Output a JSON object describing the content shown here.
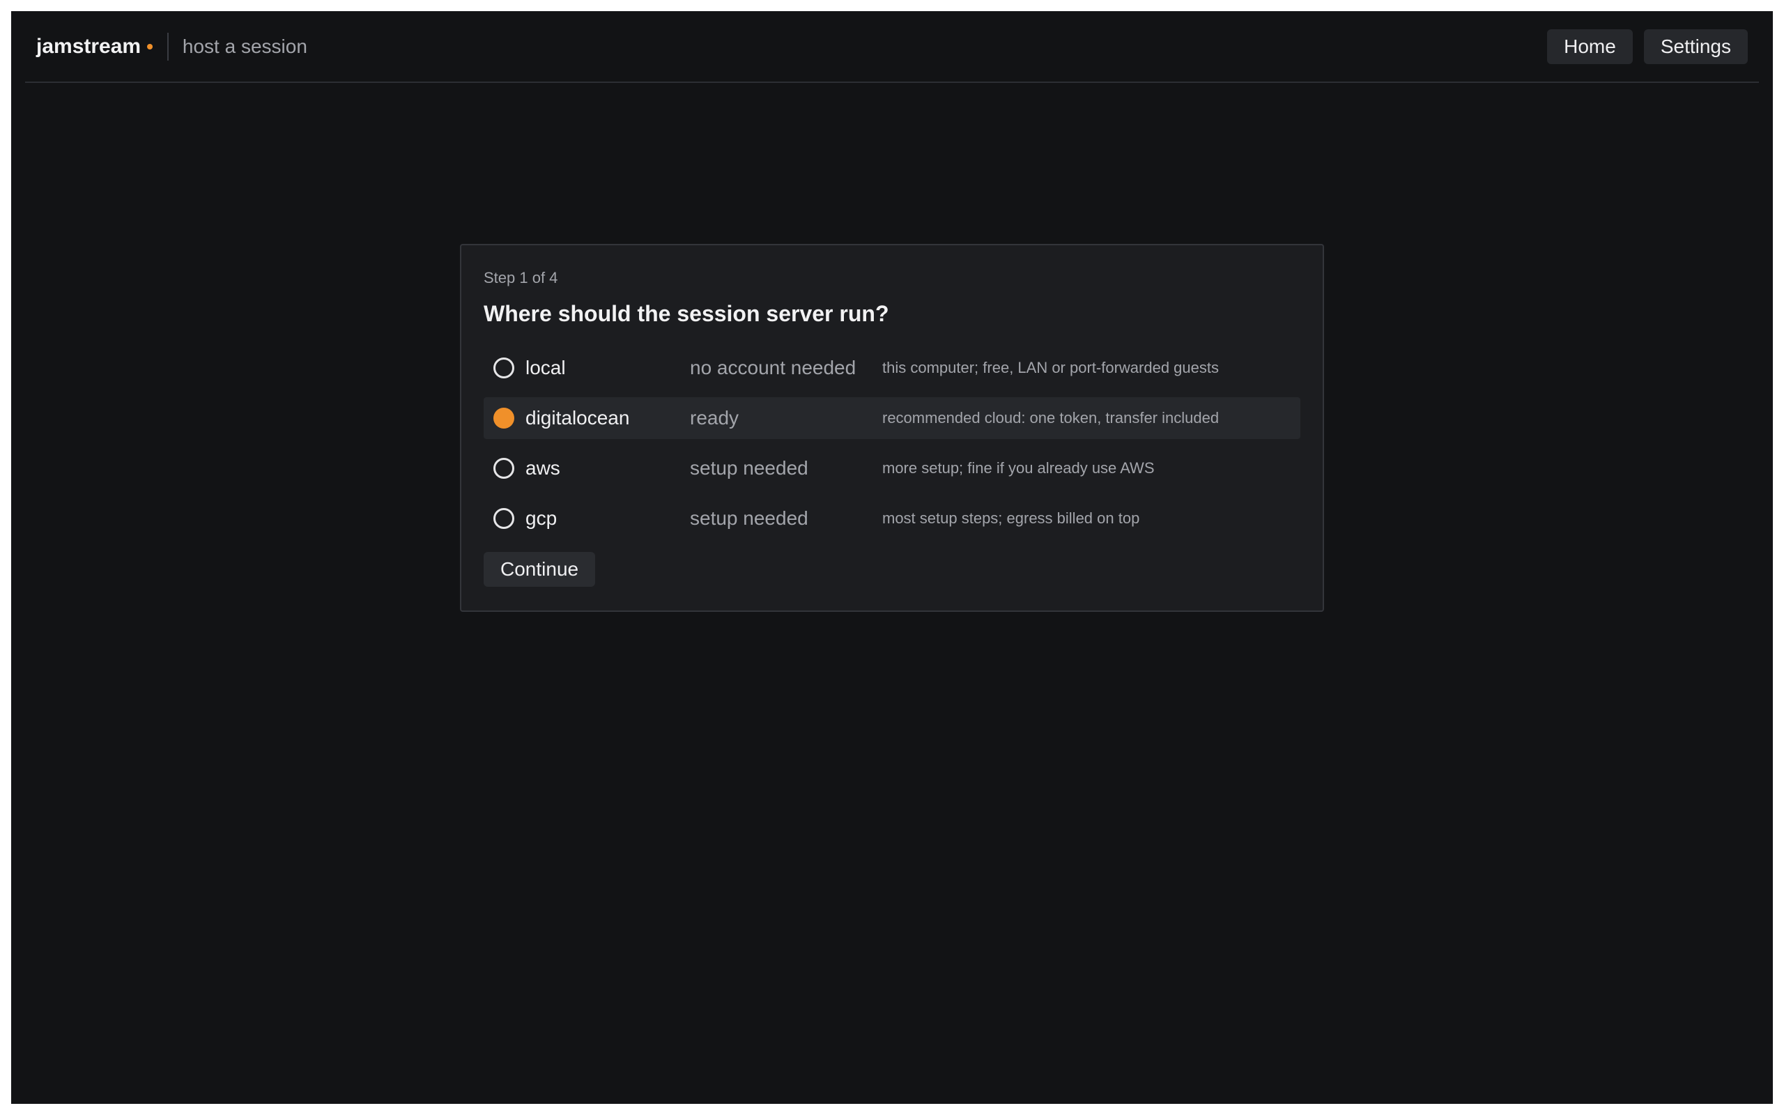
{
  "app": {
    "name": "jamstream",
    "brand_dot": "•",
    "subtitle": "host a session"
  },
  "nav": {
    "home_label": "Home",
    "settings_label": "Settings"
  },
  "wizard": {
    "step_label": "Step 1 of 4",
    "question": "Where should the session server run?",
    "options": [
      {
        "name": "local",
        "status": "no account needed",
        "description": "this computer; free, LAN or port-forwarded guests",
        "selected": false
      },
      {
        "name": "digitalocean",
        "status": "ready",
        "description": "recommended cloud: one token, transfer included",
        "selected": true
      },
      {
        "name": "aws",
        "status": "setup needed",
        "description": "more setup; fine if you already use AWS",
        "selected": false
      },
      {
        "name": "gcp",
        "status": "setup needed",
        "description": "most setup steps; egress billed on top",
        "selected": false
      }
    ],
    "continue_label": "Continue"
  },
  "colors": {
    "background": "#121315",
    "card": "#1c1d20",
    "accent": "#f0902a"
  }
}
